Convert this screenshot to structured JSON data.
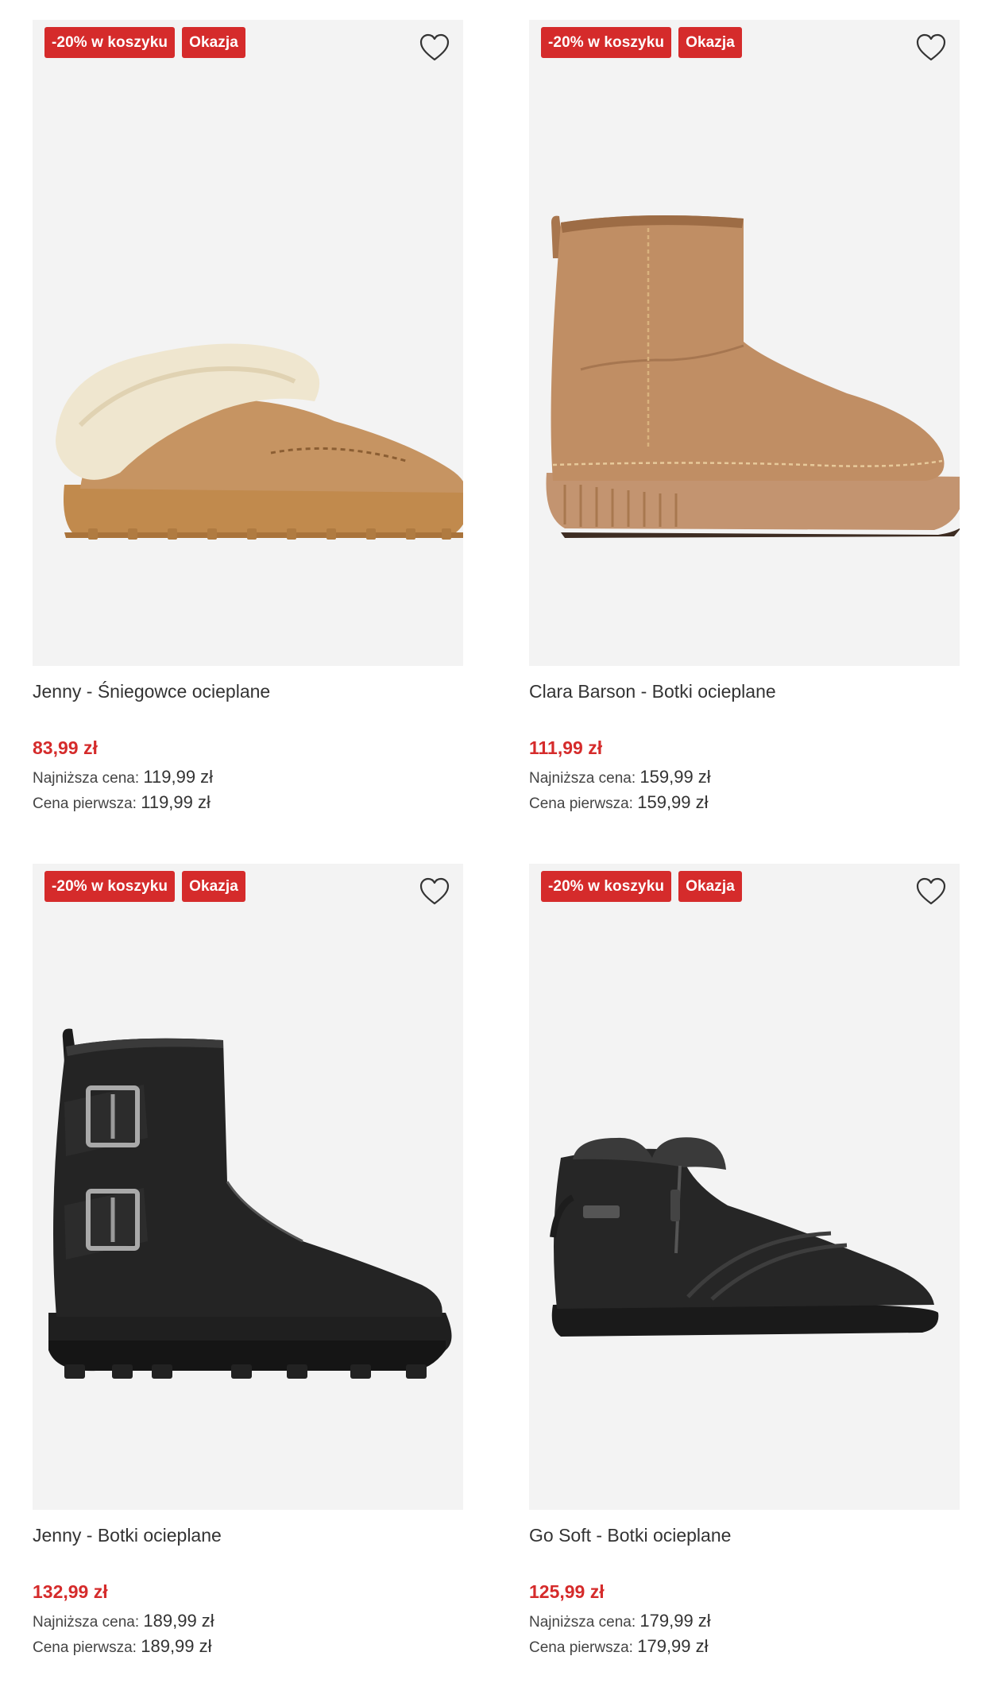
{
  "products": [
    {
      "badges": [
        "-20% w koszyku",
        "Okazja"
      ],
      "title": "Jenny - Śniegowce ocieplane",
      "price": "83,99 zł",
      "lowest_label": "Najniższa cena:",
      "lowest_value": "119,99 zł",
      "first_label": "Cena pierwsza:",
      "first_value": "119,99 zł"
    },
    {
      "badges": [
        "-20% w koszyku",
        "Okazja"
      ],
      "title": "Clara Barson - Botki ocieplane",
      "price": "111,99 zł",
      "lowest_label": "Najniższa cena:",
      "lowest_value": "159,99 zł",
      "first_label": "Cena pierwsza:",
      "first_value": "159,99 zł"
    },
    {
      "badges": [
        "-20% w koszyku",
        "Okazja"
      ],
      "title": "Jenny - Botki ocieplane",
      "price": "132,99 zł",
      "lowest_label": "Najniższa cena:",
      "lowest_value": "189,99 zł",
      "first_label": "Cena pierwsza:",
      "first_value": "189,99 zł"
    },
    {
      "badges": [
        "-20% w koszyku",
        "Okazja"
      ],
      "title": "Go Soft - Botki ocieplane",
      "price": "125,99 zł",
      "lowest_label": "Najniższa cena:",
      "lowest_value": "179,99 zł",
      "first_label": "Cena pierwsza:",
      "first_value": "179,99 zł"
    }
  ],
  "icons": {
    "wishlist": "heart-outline-icon"
  },
  "colors": {
    "badge": "#d52b2b",
    "price": "#d52b2b",
    "image_bg": "#f3f3f3"
  }
}
